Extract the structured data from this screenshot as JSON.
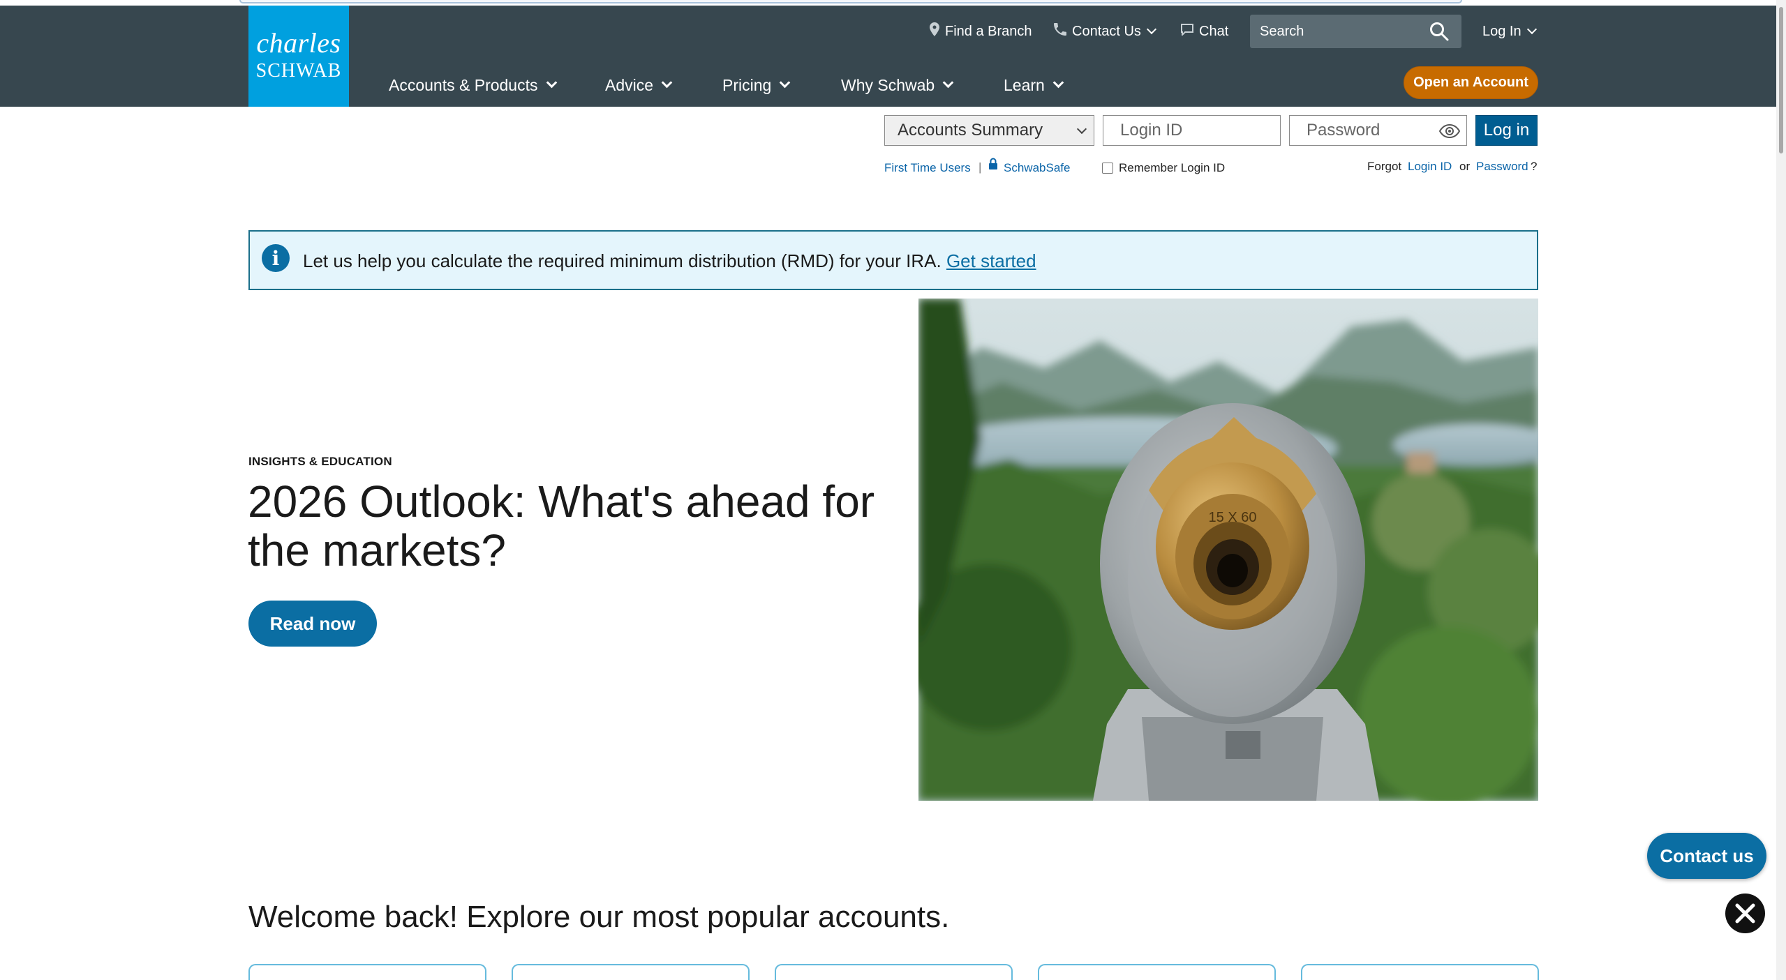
{
  "logo": {
    "line1": "charles",
    "line2": "SCHWAB"
  },
  "utility_nav": {
    "find_branch": "Find a Branch",
    "contact_us": "Contact Us",
    "chat": "Chat",
    "search_placeholder": "Search",
    "log_in": "Log In"
  },
  "main_nav": {
    "items": [
      {
        "label": "Accounts & Products"
      },
      {
        "label": "Advice"
      },
      {
        "label": "Pricing"
      },
      {
        "label": "Why Schwab"
      },
      {
        "label": "Learn"
      }
    ],
    "open_account": "Open an Account"
  },
  "login": {
    "destination_selected": "Accounts Summary",
    "login_id_placeholder": "Login ID",
    "password_placeholder": "Password",
    "login_button": "Log in",
    "first_time_users": "First Time Users",
    "separator": "|",
    "schwabsafe": "SchwabSafe",
    "remember_login": "Remember Login ID",
    "forgot_prefix": "Forgot",
    "forgot_login_id": "Login ID",
    "forgot_or": "or",
    "forgot_password": "Password",
    "forgot_suffix": "?"
  },
  "banner": {
    "message": "Let us help you calculate the required minimum distribution (RMD) for your IRA.",
    "link": "Get started"
  },
  "hero": {
    "eyebrow": "INSIGHTS & EDUCATION",
    "title": "2026 Outlook: What's ahead for the markets?",
    "button": "Read now",
    "image_text": "15 X 60"
  },
  "welcome": {
    "heading": "Welcome back! Explore our most popular accounts."
  },
  "floating": {
    "contact_us": "Contact us"
  },
  "colors": {
    "header_bg": "#37474f",
    "logo_bg": "#00a0df",
    "primary_blue": "#0b6ea3",
    "open_account_orange": "#c76b00",
    "banner_bg": "#e4f5fc"
  }
}
